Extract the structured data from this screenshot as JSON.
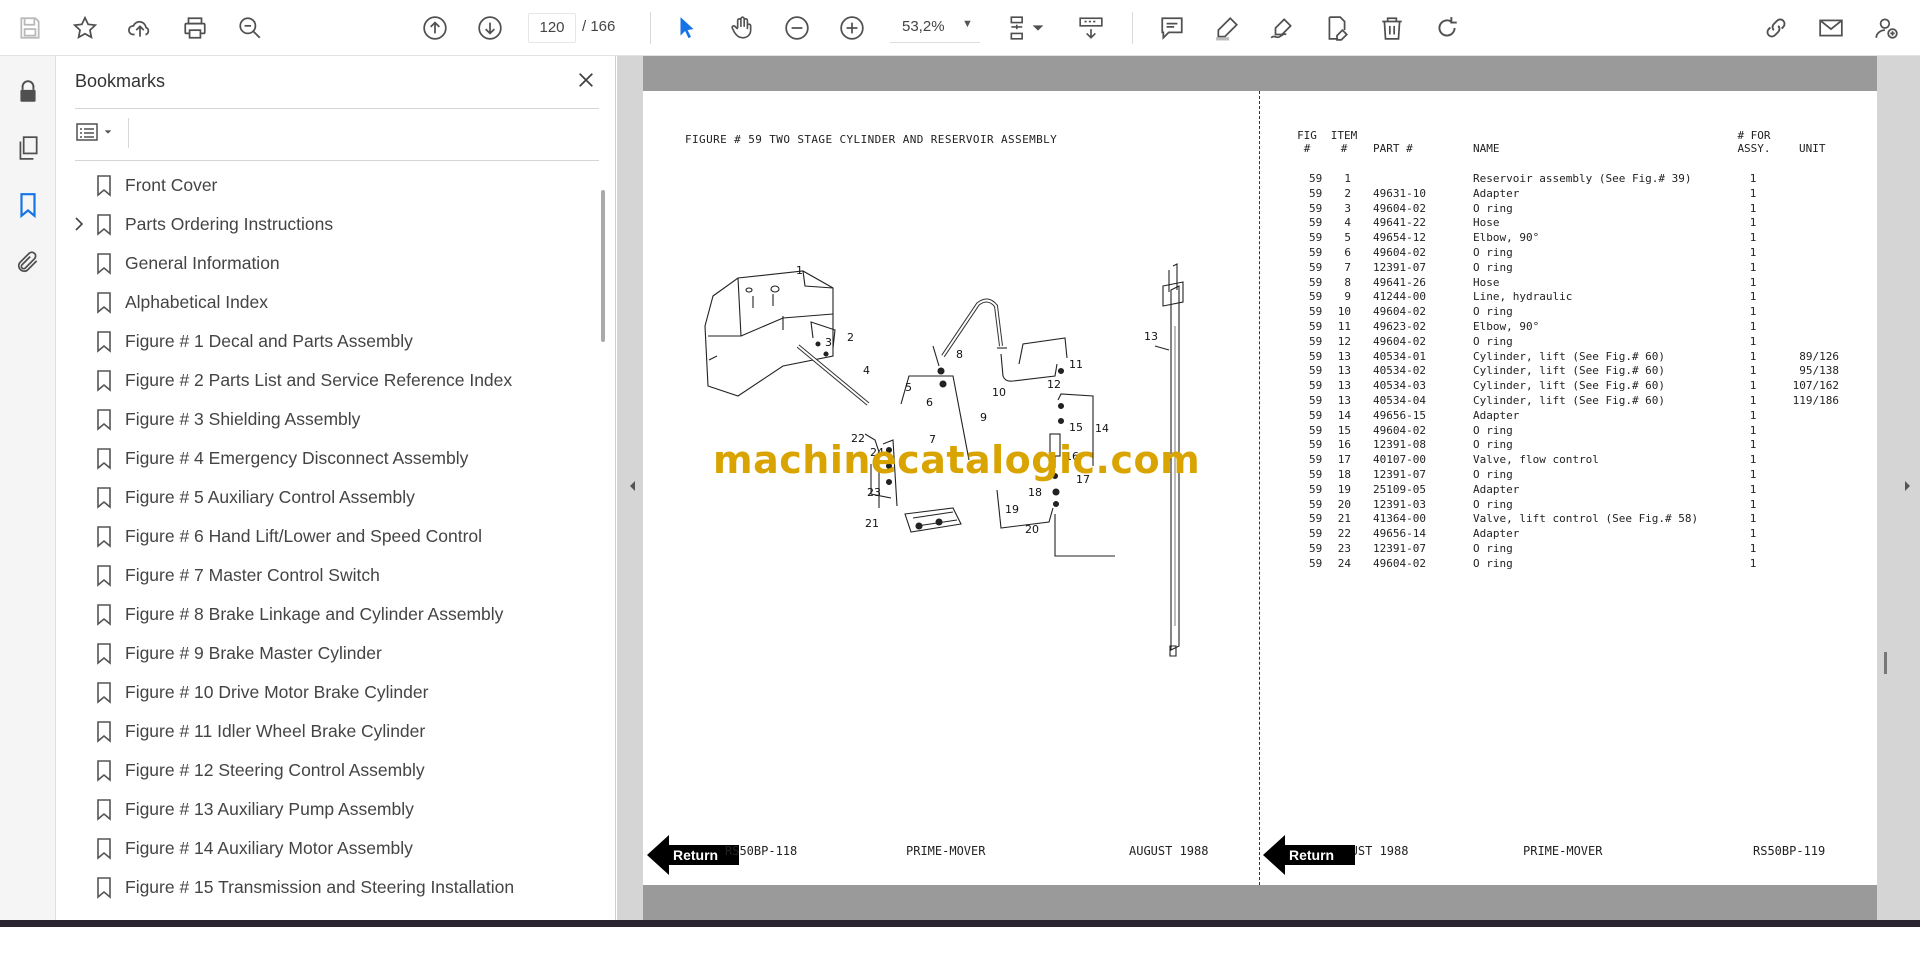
{
  "toolbar": {
    "page_current": "120",
    "page_total": "/ 166",
    "zoom": "53,2%"
  },
  "bookmarks": {
    "title": "Bookmarks",
    "items": [
      {
        "label": "Front Cover",
        "expandable": false
      },
      {
        "label": "Parts Ordering Instructions",
        "expandable": true
      },
      {
        "label": "General Information",
        "expandable": false
      },
      {
        "label": "Alphabetical Index",
        "expandable": false
      },
      {
        "label": "Figure # 1 Decal and Parts Assembly",
        "expandable": false
      },
      {
        "label": "Figure # 2 Parts List and Service Reference Index",
        "expandable": false
      },
      {
        "label": "Figure # 3 Shielding Assembly",
        "expandable": false
      },
      {
        "label": "Figure # 4 Emergency Disconnect Assembly",
        "expandable": false
      },
      {
        "label": "Figure # 5 Auxiliary Control Assembly",
        "expandable": false
      },
      {
        "label": "Figure # 6 Hand Lift/Lower and Speed Control",
        "expandable": false
      },
      {
        "label": "Figure # 7 Master Control Switch",
        "expandable": false
      },
      {
        "label": "Figure # 8 Brake Linkage and Cylinder Assembly",
        "expandable": false
      },
      {
        "label": "Figure # 9 Brake Master Cylinder",
        "expandable": false
      },
      {
        "label": "Figure # 10 Drive Motor Brake Cylinder",
        "expandable": false
      },
      {
        "label": "Figure # 11 Idler Wheel Brake Cylinder",
        "expandable": false
      },
      {
        "label": "Figure # 12 Steering Control Assembly",
        "expandable": false
      },
      {
        "label": "Figure # 13 Auxiliary Pump Assembly",
        "expandable": false
      },
      {
        "label": "Figure # 14 Auxiliary Motor Assembly",
        "expandable": false
      },
      {
        "label": "Figure # 15 Transmission and Steering Installation",
        "expandable": false
      }
    ]
  },
  "page": {
    "figure_title": "FIGURE # 59 TWO STAGE CYLINDER AND RESERVOIR ASSEMBLY",
    "watermark": "machinecatalogic.com",
    "left_footer": {
      "code": "RS50BP-118",
      "center": "PRIME-MOVER",
      "date": "AUGUST 1988"
    },
    "right_footer": {
      "date": "AUGUST 1988",
      "center": "PRIME-MOVER",
      "code": "RS50BP-119"
    },
    "return_label": "Return",
    "callouts": [
      "1",
      "2",
      "3",
      "4",
      "5",
      "6",
      "7",
      "8",
      "9",
      "10",
      "11",
      "12",
      "13",
      "14",
      "15",
      "16",
      "17",
      "18",
      "19",
      "20",
      "21",
      "22",
      "23",
      "24"
    ],
    "table": {
      "headers": {
        "fig": "FIG\n#",
        "item": "ITEM\n#",
        "part": "PART #",
        "name": "NAME",
        "assy": "# FOR\nASSY.",
        "unit": "UNIT"
      },
      "rows": [
        {
          "fig": "59",
          "item": "1",
          "part": "",
          "name": "Reservoir assembly (See Fig.# 39)",
          "assy": "1",
          "unit": ""
        },
        {
          "fig": "59",
          "item": "2",
          "part": "49631-10",
          "name": "Adapter",
          "assy": "1",
          "unit": ""
        },
        {
          "fig": "59",
          "item": "3",
          "part": "49604-02",
          "name": "O ring",
          "assy": "1",
          "unit": ""
        },
        {
          "fig": "59",
          "item": "4",
          "part": "49641-22",
          "name": "Hose",
          "assy": "1",
          "unit": ""
        },
        {
          "fig": "59",
          "item": "5",
          "part": "49654-12",
          "name": "Elbow, 90°",
          "assy": "1",
          "unit": ""
        },
        {
          "fig": "59",
          "item": "6",
          "part": "49604-02",
          "name": "O ring",
          "assy": "1",
          "unit": ""
        },
        {
          "fig": "59",
          "item": "7",
          "part": "12391-07",
          "name": "O ring",
          "assy": "1",
          "unit": ""
        },
        {
          "fig": "59",
          "item": "8",
          "part": "49641-26",
          "name": "Hose",
          "assy": "1",
          "unit": ""
        },
        {
          "fig": "59",
          "item": "9",
          "part": "41244-00",
          "name": "Line, hydraulic",
          "assy": "1",
          "unit": ""
        },
        {
          "fig": "59",
          "item": "10",
          "part": "49604-02",
          "name": "O ring",
          "assy": "1",
          "unit": ""
        },
        {
          "fig": "59",
          "item": "11",
          "part": "49623-02",
          "name": "Elbow, 90°",
          "assy": "1",
          "unit": ""
        },
        {
          "fig": "59",
          "item": "12",
          "part": "49604-02",
          "name": "O ring",
          "assy": "1",
          "unit": ""
        },
        {
          "fig": "59",
          "item": "13",
          "part": "40534-01",
          "name": "Cylinder, lift (See Fig.# 60)",
          "assy": "1",
          "unit": "89/126"
        },
        {
          "fig": "59",
          "item": "13",
          "part": "40534-02",
          "name": "Cylinder, lift (See Fig.# 60)",
          "assy": "1",
          "unit": "95/138"
        },
        {
          "fig": "59",
          "item": "13",
          "part": "40534-03",
          "name": "Cylinder, lift (See Fig.# 60)",
          "assy": "1",
          "unit": "107/162"
        },
        {
          "fig": "59",
          "item": "13",
          "part": "40534-04",
          "name": "Cylinder, lift (See Fig.# 60)",
          "assy": "1",
          "unit": "119/186"
        },
        {
          "fig": "59",
          "item": "14",
          "part": "49656-15",
          "name": "Adapter",
          "assy": "1",
          "unit": ""
        },
        {
          "fig": "59",
          "item": "15",
          "part": "49604-02",
          "name": "O ring",
          "assy": "1",
          "unit": ""
        },
        {
          "fig": "59",
          "item": "16",
          "part": "12391-08",
          "name": "O ring",
          "assy": "1",
          "unit": ""
        },
        {
          "fig": "59",
          "item": "17",
          "part": "40107-00",
          "name": "Valve, flow control",
          "assy": "1",
          "unit": ""
        },
        {
          "fig": "59",
          "item": "18",
          "part": "12391-07",
          "name": "O ring",
          "assy": "1",
          "unit": ""
        },
        {
          "fig": "59",
          "item": "19",
          "part": "25109-05",
          "name": "Adapter",
          "assy": "1",
          "unit": ""
        },
        {
          "fig": "59",
          "item": "20",
          "part": "12391-03",
          "name": "O ring",
          "assy": "1",
          "unit": ""
        },
        {
          "fig": "59",
          "item": "21",
          "part": "41364-00",
          "name": "Valve, lift control (See Fig.# 58)",
          "assy": "1",
          "unit": ""
        },
        {
          "fig": "59",
          "item": "22",
          "part": "49656-14",
          "name": "Adapter",
          "assy": "1",
          "unit": ""
        },
        {
          "fig": "59",
          "item": "23",
          "part": "12391-07",
          "name": "O ring",
          "assy": "1",
          "unit": ""
        },
        {
          "fig": "59",
          "item": "24",
          "part": "49604-02",
          "name": "O ring",
          "assy": "1",
          "unit": ""
        }
      ]
    }
  },
  "colors": {
    "accent": "#1473e6",
    "icon": "#505050",
    "watermark": "#d9a400"
  }
}
